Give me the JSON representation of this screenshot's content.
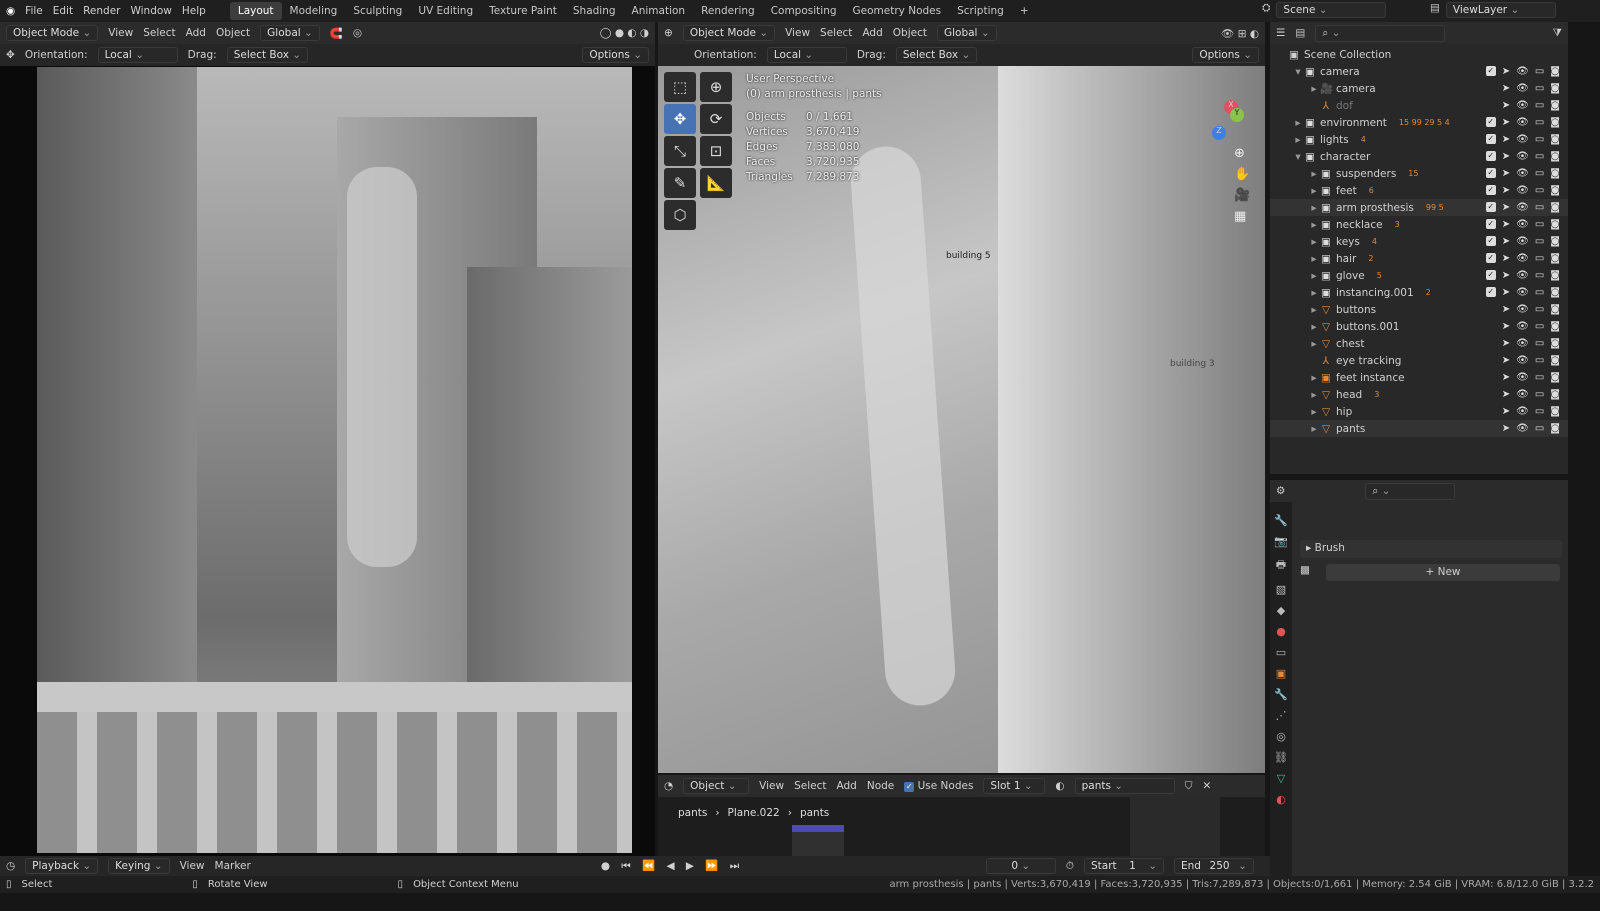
{
  "topbar": {
    "menus": [
      "File",
      "Edit",
      "Render",
      "Window",
      "Help"
    ],
    "workspaces": [
      "Layout",
      "Modeling",
      "Sculpting",
      "UV Editing",
      "Texture Paint",
      "Shading",
      "Animation",
      "Rendering",
      "Compositing",
      "Geometry Nodes",
      "Scripting"
    ],
    "active_workspace": "Layout",
    "add_label": "+",
    "scene": "Scene",
    "view_layer": "ViewLayer"
  },
  "left_view": {
    "mode": "Object Mode",
    "menus": [
      "View",
      "Select",
      "Add",
      "Object"
    ],
    "transform": "Global",
    "orientation_label": "Orientation:",
    "orientation": "Local",
    "drag_label": "Drag:",
    "drag": "Select Box",
    "options": "Options"
  },
  "right_view": {
    "mode": "Object Mode",
    "menus": [
      "View",
      "Select",
      "Add",
      "Object"
    ],
    "transform": "Global",
    "orientation_label": "Orientation:",
    "orientation": "Local",
    "drag_label": "Drag:",
    "drag": "Select Box",
    "options": "Options",
    "overlay_title": "User Perspective",
    "overlay_sub": "(0) arm prosthesis | pants",
    "stats": [
      [
        "Objects",
        "0 / 1,661"
      ],
      [
        "Vertices",
        "3,670,419"
      ],
      [
        "Edges",
        "7,383,080"
      ],
      [
        "Faces",
        "3,720,935"
      ],
      [
        "Triangles",
        "7,289,873"
      ]
    ],
    "labels": [
      "building 5",
      "building 3"
    ],
    "gizmo": {
      "x": "X",
      "y": "Y",
      "z": "Z"
    }
  },
  "node_editor": {
    "type": "Object",
    "menus": [
      "View",
      "Select",
      "Add",
      "Node"
    ],
    "use_nodes": "Use Nodes",
    "slot": "Slot 1",
    "material": "pants",
    "breadcrumb": [
      "pants",
      "Plane.022",
      "pants"
    ]
  },
  "outliner": {
    "root": "Scene Collection",
    "rows": [
      {
        "label": "camera",
        "depth": 0,
        "kind": "collection",
        "open": true,
        "check": true
      },
      {
        "label": "camera",
        "depth": 1,
        "kind": "camera",
        "check": false
      },
      {
        "label": "dof",
        "depth": 1,
        "kind": "empty",
        "check": false,
        "dim": true
      },
      {
        "label": "environment",
        "depth": 0,
        "kind": "collection",
        "check": true,
        "badges": "15 99 29 5 4"
      },
      {
        "label": "lights",
        "depth": 0,
        "kind": "collection",
        "check": true,
        "badges": "4"
      },
      {
        "label": "character",
        "depth": 0,
        "kind": "collection",
        "open": true,
        "check": true
      },
      {
        "label": "suspenders",
        "depth": 1,
        "kind": "collection",
        "check": true,
        "badges": "15"
      },
      {
        "label": "feet",
        "depth": 1,
        "kind": "collection",
        "check": true,
        "badges": "6"
      },
      {
        "label": "arm prosthesis",
        "depth": 1,
        "kind": "collection",
        "check": true,
        "badges": "99 5"
      },
      {
        "label": "necklace",
        "depth": 1,
        "kind": "collection",
        "check": true,
        "badges": "3"
      },
      {
        "label": "keys",
        "depth": 1,
        "kind": "collection",
        "check": true,
        "badges": "4"
      },
      {
        "label": "hair",
        "depth": 1,
        "kind": "collection",
        "check": true,
        "badges": "2"
      },
      {
        "label": "glove",
        "depth": 1,
        "kind": "collection",
        "check": true,
        "badges": "5"
      },
      {
        "label": "instancing.001",
        "depth": 1,
        "kind": "collection",
        "check": true,
        "badges": "2"
      },
      {
        "label": "buttons",
        "depth": 1,
        "kind": "mesh",
        "check": false
      },
      {
        "label": "buttons.001",
        "depth": 1,
        "kind": "mesh",
        "check": false
      },
      {
        "label": "chest",
        "depth": 1,
        "kind": "mesh",
        "check": false
      },
      {
        "label": "eye tracking",
        "depth": 1,
        "kind": "empty",
        "check": false
      },
      {
        "label": "feet instance",
        "depth": 1,
        "kind": "instance",
        "check": false
      },
      {
        "label": "head",
        "depth": 1,
        "kind": "mesh",
        "check": false,
        "badges": "3"
      },
      {
        "label": "hip",
        "depth": 1,
        "kind": "mesh",
        "check": false
      },
      {
        "label": "pants",
        "depth": 1,
        "kind": "mesh",
        "check": false
      }
    ]
  },
  "properties": {
    "brush_label": "Brush",
    "new_label": "New"
  },
  "timeline": {
    "menus": [
      "Playback",
      "Keying",
      "View",
      "Marker"
    ],
    "current_frame": "0",
    "start_label": "Start",
    "start": "1",
    "end_label": "End",
    "end": "250"
  },
  "status": {
    "hints": [
      "Select",
      "Rotate View",
      "Object Context Menu"
    ],
    "info": "arm prosthesis | pants | Verts:3,670,419 | Faces:3,720,935 | Tris:7,289,873 | Objects:0/1,661 | Memory: 2.54 GiB | VRAM: 6.8/12.0 GiB | 3.2.2"
  },
  "colors": {
    "accent": "#4772b3",
    "object_orange": "#e08a3c",
    "data_green": "#3fbf8f"
  }
}
